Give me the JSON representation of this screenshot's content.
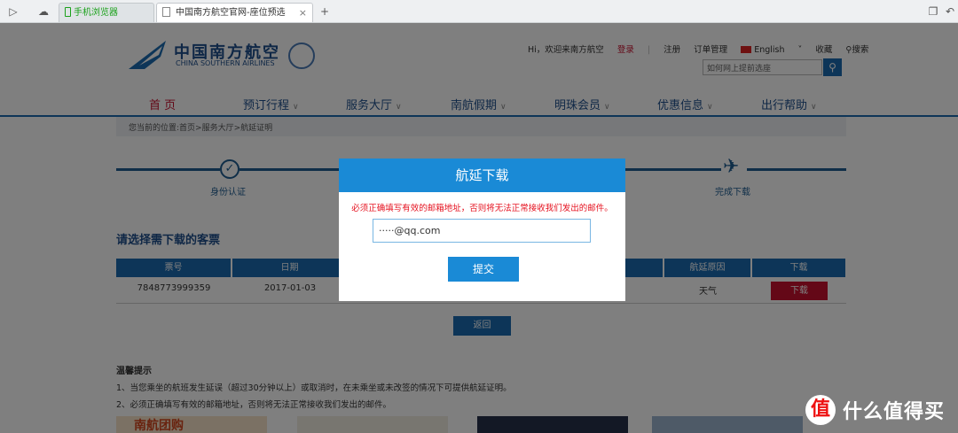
{
  "browser": {
    "tab1": "手机浏览器",
    "tab2": "中国南方航空官网-座位预选",
    "new_tab": "+",
    "close": "×"
  },
  "site": {
    "logo_cn": "中国南方航空",
    "logo_en": "CHINA SOUTHERN AIRLINES",
    "greeting": "Hi，欢迎来南方航空",
    "login": "登录",
    "register": "注册",
    "order_manage": "订单管理",
    "language": "English",
    "favorites": "收藏",
    "search_link": "搜索",
    "search_placeholder": "如何网上提前选座"
  },
  "nav": [
    {
      "label": "首 页"
    },
    {
      "label": "预订行程"
    },
    {
      "label": "服务大厅"
    },
    {
      "label": "南航假期"
    },
    {
      "label": "明珠会员"
    },
    {
      "label": "优惠信息"
    },
    {
      "label": "出行帮助"
    }
  ],
  "breadcrumb": "您当前的位置:首页>服务大厅>航延证明",
  "steps": {
    "step1": "身份认证",
    "step3": "完成下载"
  },
  "section_title": "请选择需下载的客票",
  "table": {
    "headers": {
      "ticket_no": "票号",
      "date": "日期",
      "delay_reason": "航延原因",
      "download": "下载"
    },
    "row": {
      "ticket_no": "7848773999359",
      "date": "2017-01-03",
      "delay_reason": "天气",
      "download": "下载"
    }
  },
  "back_button": "返回",
  "tips": {
    "title": "温馨提示",
    "line1": "1、当您乘坐的航班发生延误（超过30分钟以上）或取消时，在未乘坐或未改签的情况下可提供航延证明。",
    "line2": "2、必须正确填写有效的邮箱地址，否则将无法正常接收我们发出的邮件。"
  },
  "banners": {
    "b1": "南航团购"
  },
  "modal": {
    "title": "航延下载",
    "warning": "必须正确填写有效的邮箱地址，否则将无法正常接收我们发出的邮件。",
    "email_value": "·····@qq.com",
    "submit": "提交"
  },
  "watermark": {
    "icon": "值",
    "text": "什么值得买"
  },
  "colors": {
    "brand_blue": "#1a6bb0",
    "modal_blue": "#1a8ad6",
    "brand_red": "#c8102e"
  }
}
